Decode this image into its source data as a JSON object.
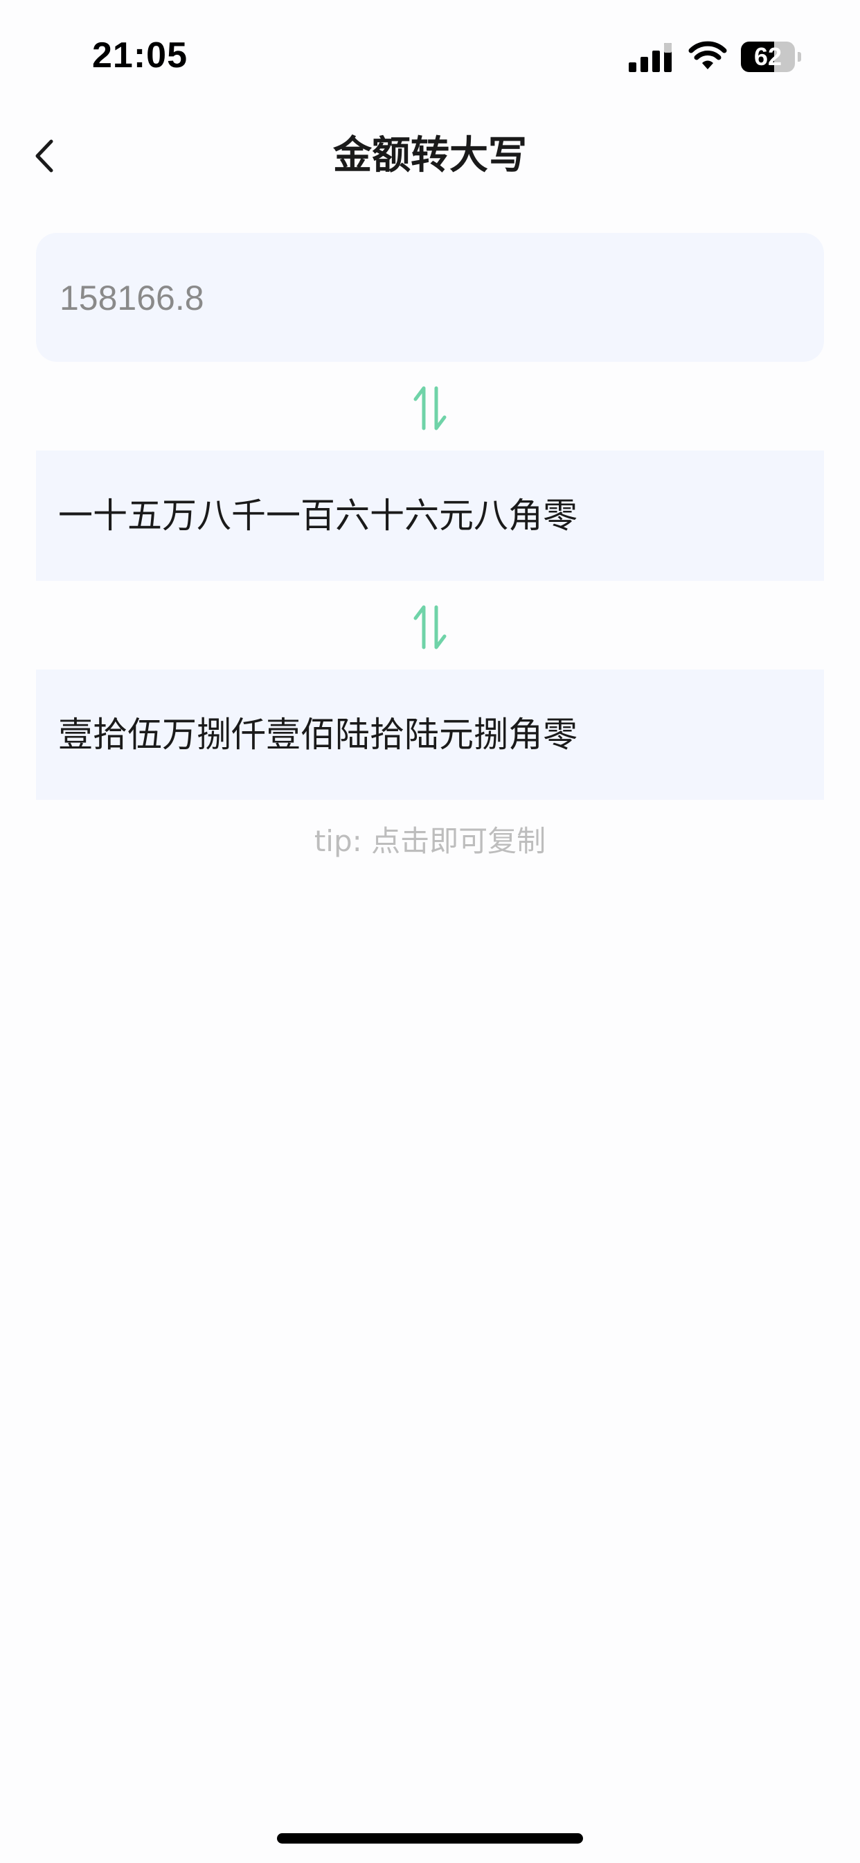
{
  "status_bar": {
    "time": "21:05",
    "battery_level": "62",
    "battery_fraction": 0.62
  },
  "header": {
    "title": "金额转大写",
    "back_icon": "chevron-left-icon"
  },
  "input": {
    "placeholder": "158166.8",
    "value": ""
  },
  "swap_icon": "swap-vertical-arrows-icon",
  "results": [
    {
      "label": "一十五万八千一百六十六元八角零"
    },
    {
      "label": "壹拾伍万捌仟壹佰陆拾陆元捌角零"
    }
  ],
  "tip": "tip: 点击即可复制",
  "colors": {
    "accent": "#6fd3a8",
    "card_background": "#f3f6fe",
    "tip_text": "#bdbdbd"
  }
}
